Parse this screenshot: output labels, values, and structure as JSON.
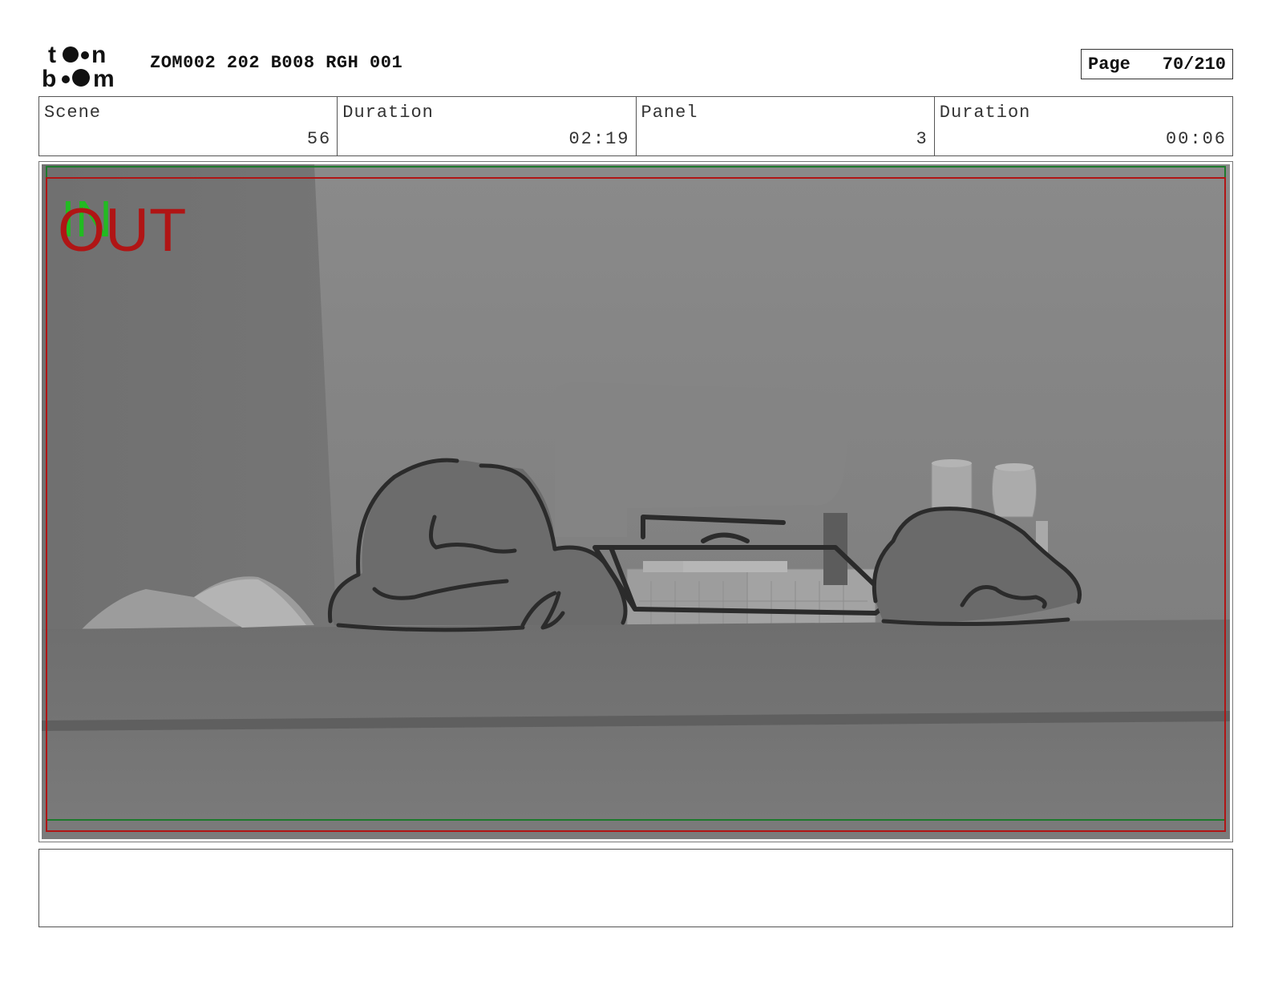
{
  "header": {
    "logo_text": "toon boom",
    "project_title": "ZOM002 202 B008 RGH 001",
    "page_label": "Page",
    "page_value": "70/210"
  },
  "info": {
    "scene_label": "Scene",
    "scene_value": "56",
    "scene_duration_label": "Duration",
    "scene_duration_value": "02:19",
    "panel_label": "Panel",
    "panel_value": "3",
    "panel_duration_label": "Duration",
    "panel_duration_value": "00:06"
  },
  "panel": {
    "in_marker": "IN",
    "out_marker": "OUT",
    "in_color": "#22bb22",
    "out_color": "#b01515",
    "safe_frame_color": "#b01515",
    "field_frame_color": "#1d7a2c"
  },
  "notes": {
    "text": ""
  }
}
